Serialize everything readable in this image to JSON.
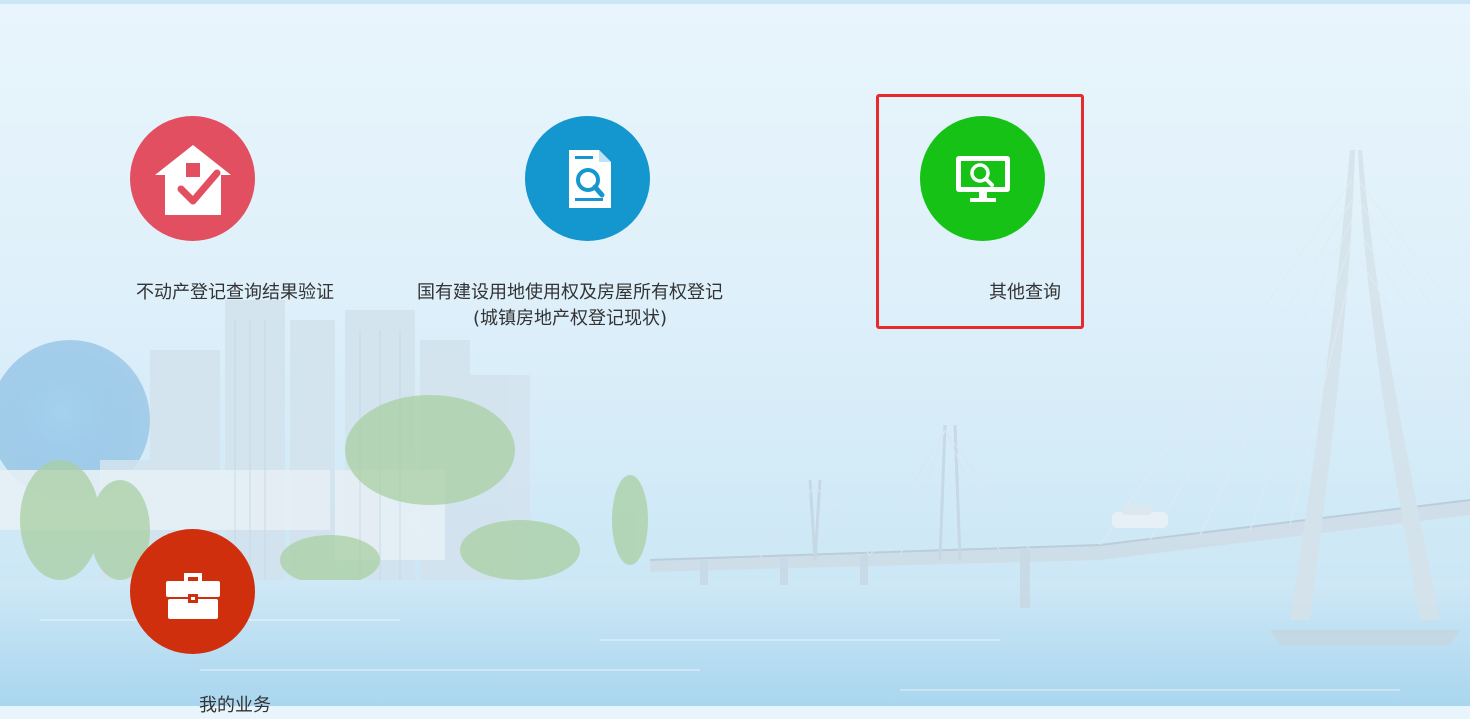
{
  "tiles": [
    {
      "label": "不动产登记查询结果验证",
      "color": "#e14f60",
      "icon": "house-check-icon"
    },
    {
      "label_line1": "国有建设用地使用权及房屋所有权登记",
      "label_line2": "(城镇房地产权登记现状)",
      "color": "#1497cf",
      "icon": "document-search-icon"
    },
    {
      "label": "其他查询",
      "color": "#16c216",
      "icon": "monitor-search-icon",
      "selected": true
    },
    {
      "label": "我的业务",
      "color": "#cf2f0d",
      "icon": "briefcase-icon"
    }
  ],
  "colors": {
    "background": "#dff0fa",
    "selection_border": "#e82a2a",
    "label_text": "#333333"
  }
}
